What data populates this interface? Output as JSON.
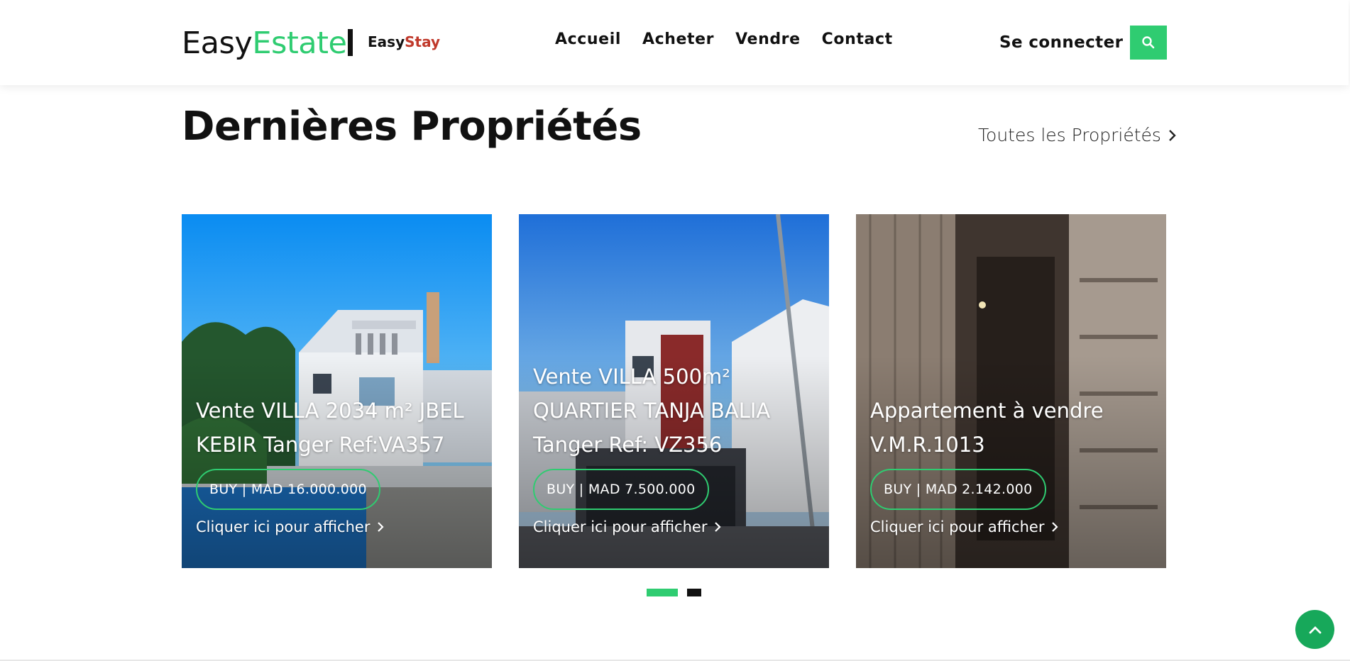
{
  "header": {
    "logo_part1": "Easy",
    "logo_part2": "Estate",
    "sub_logo_part1": "Easy",
    "sub_logo_part2": "Stay",
    "nav": [
      "Accueil",
      "Acheter",
      "Vendre",
      "Contact"
    ],
    "login_label": "Se connecter",
    "search_icon": "search-icon"
  },
  "section": {
    "title": "Dernières Propriétés",
    "all_link": "Toutes les Propriétés"
  },
  "cards": [
    {
      "title_line1": "Vente VILLA 2034 m² JBEL",
      "title_line2": "KEBIR Tanger Ref:VA357",
      "price": "BUY | MAD 16.000.000",
      "link": "Cliquer ici pour afficher"
    },
    {
      "title_line1": "Vente VILLA 500m²",
      "title_line2": "QUARTIER TANJA BALIA",
      "title_line3": "Tanger Ref: VZ356",
      "price": "BUY | MAD 7.500.000",
      "link": "Cliquer ici pour afficher"
    },
    {
      "title_line1": "Appartement à vendre",
      "title_line2": "V.M.R.1013",
      "price": "BUY | MAD 2.142.000",
      "link": "Cliquer ici pour afficher"
    }
  ],
  "pagination": {
    "pages": 2,
    "current": 1
  },
  "colors": {
    "accent": "#2fcc71",
    "stay_red": "#c0392b",
    "to_top": "#17a85a"
  }
}
